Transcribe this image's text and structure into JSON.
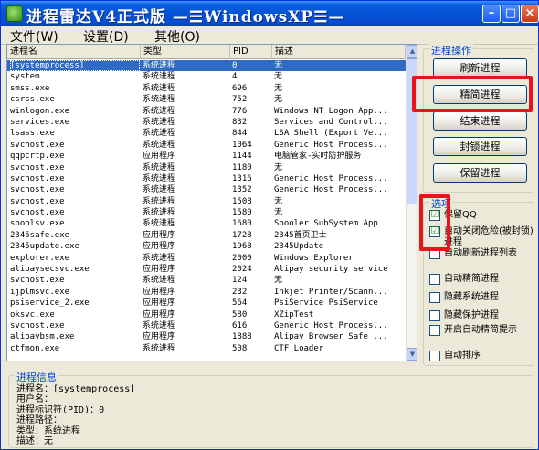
{
  "window": {
    "title": "进程雷达V4正式版 —☰WindowsXP☰—"
  },
  "menu": [
    {
      "label": "文件(W)"
    },
    {
      "label": "设置(D)"
    },
    {
      "label": "其他(O)"
    }
  ],
  "table": {
    "columns": [
      "进程名",
      "类型",
      "PID",
      "描述"
    ],
    "rows": [
      [
        "[systemprocess]",
        "系统进程",
        "0",
        "无"
      ],
      [
        "system",
        "系统进程",
        "4",
        "无"
      ],
      [
        "smss.exe",
        "系统进程",
        "696",
        "无"
      ],
      [
        "csrss.exe",
        "系统进程",
        "752",
        "无"
      ],
      [
        "winlogon.exe",
        "系统进程",
        "776",
        "Windows NT Logon App..."
      ],
      [
        "services.exe",
        "系统进程",
        "832",
        "Services and Control..."
      ],
      [
        "lsass.exe",
        "系统进程",
        "844",
        "LSA Shell (Export Ve..."
      ],
      [
        "svchost.exe",
        "系统进程",
        "1064",
        "Generic Host Process..."
      ],
      [
        "qqpcrtp.exe",
        "应用程序",
        "1144",
        "电脑管家-实时防护服务"
      ],
      [
        "svchost.exe",
        "系统进程",
        "1180",
        "无"
      ],
      [
        "svchost.exe",
        "系统进程",
        "1316",
        "Generic Host Process..."
      ],
      [
        "svchost.exe",
        "系统进程",
        "1352",
        "Generic Host Process..."
      ],
      [
        "svchost.exe",
        "系统进程",
        "1508",
        "无"
      ],
      [
        "svchost.exe",
        "系统进程",
        "1580",
        "无"
      ],
      [
        "spoolsv.exe",
        "系统进程",
        "1680",
        "Spooler SubSystem App"
      ],
      [
        "2345safe.exe",
        "应用程序",
        "1728",
        "2345首页卫士"
      ],
      [
        "2345update.exe",
        "应用程序",
        "1968",
        "2345Update"
      ],
      [
        "explorer.exe",
        "系统进程",
        "2000",
        "Windows Explorer"
      ],
      [
        "alipaysecsvc.exe",
        "应用程序",
        "2024",
        "Alipay security service"
      ],
      [
        "svchost.exe",
        "系统进程",
        "124",
        "无"
      ],
      [
        "ijplmsvc.exe",
        "应用程序",
        "232",
        "Inkjet Printer/Scann..."
      ],
      [
        "psiservice_2.exe",
        "应用程序",
        "564",
        "PsiService PsiService"
      ],
      [
        "oksvc.exe",
        "应用程序",
        "580",
        "XZipTest"
      ],
      [
        "svchost.exe",
        "系统进程",
        "616",
        "Generic Host Process..."
      ],
      [
        "alipaybsm.exe",
        "应用程序",
        "1888",
        "Alipay Browser Safe ..."
      ],
      [
        "ctfmon.exe",
        "系统进程",
        "508",
        "CTF Loader"
      ]
    ]
  },
  "ops": {
    "title": "进程操作",
    "buttons": [
      "刷新进程",
      "精简进程",
      "结束进程",
      "封锁进程",
      "保留进程"
    ]
  },
  "options": {
    "title": "选项",
    "items": [
      {
        "label": "保留QQ",
        "checked": "☑"
      },
      {
        "label": "自动关闭危险(被封锁)进程",
        "checked": "☑"
      },
      {
        "label": "自动刷新进程列表",
        "checked": ""
      },
      {
        "label": "自动精简进程",
        "checked": ""
      },
      {
        "label": "隐藏系统进程",
        "checked": ""
      },
      {
        "label": "隐藏保护进程",
        "checked": ""
      },
      {
        "label": "开启自动精简提示",
        "checked": ""
      },
      {
        "label": "自动排序",
        "checked": ""
      }
    ]
  },
  "info": {
    "title": "进程信息",
    "lines": [
      "进程名：[systemprocess]",
      "用户名：",
      "进程标识符(PID)：0",
      "进程路径：",
      "类型：系统进程",
      "描述：无"
    ]
  },
  "colors": {
    "accent": "#0453d6",
    "selection": "#316ac5",
    "highlight_frame": "#e8141c"
  }
}
